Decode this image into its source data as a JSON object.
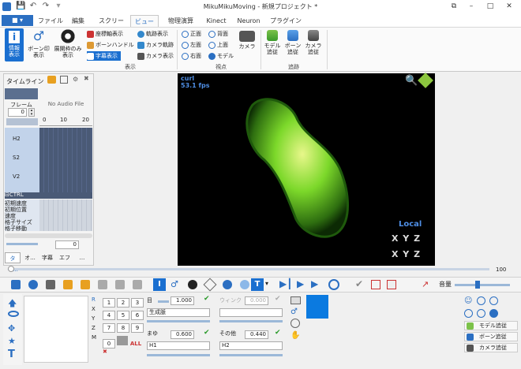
{
  "window": {
    "title": "MikuMikuMoving - 新規プロジェクト *"
  },
  "quick_access": [
    "save",
    "undo",
    "redo"
  ],
  "menu_tabs": [
    {
      "label": "ファイル",
      "active": false
    },
    {
      "label": "編集",
      "active": false
    },
    {
      "label": "スクリーン",
      "active": false
    },
    {
      "label": "ビュー",
      "active": true
    },
    {
      "label": "物理演算",
      "active": false
    },
    {
      "label": "Kinect",
      "active": false
    },
    {
      "label": "Neuron",
      "active": false
    },
    {
      "label": "プラグイン",
      "active": false
    }
  ],
  "file_button": "■ ▾",
  "ribbon": {
    "display_group": "表示",
    "viewpoint_group": "視点",
    "tracking_group": "追跡",
    "info_btn": "情報\n表示",
    "bone_mark_btn": "ボーン印\n表示",
    "expand_only_btn": "展開枠のみ\n表示",
    "small_items": [
      "座標軸表示",
      "ボーンハンドル",
      "字幕表示",
      "軌跡表示",
      "カメラ軌跡",
      "カメラ表示"
    ],
    "view_items": [
      "正面",
      "背面",
      "左面",
      "上面",
      "右面",
      "モデル"
    ],
    "camera_btn": "カメラ",
    "track_items": [
      "モデル\n追従",
      "ボーン\n追従",
      "カメラ\n追従"
    ]
  },
  "timeline": {
    "title": "タイムライン",
    "frame_label": "フレーム",
    "frame_value": "0",
    "audio": "No Audio File",
    "ticks": [
      "0",
      "10",
      "20"
    ],
    "tracks": [
      "H2",
      "S2",
      "V2"
    ],
    "ctrl_items": [
      "⊟CTRL",
      "初期速度",
      "初期位置",
      "速度",
      "格子サイズ",
      "格子移動"
    ],
    "bottom_value": "0",
    "tabs": [
      "タイ...",
      "オ...",
      "字幕",
      "エフ",
      "..."
    ]
  },
  "viewport": {
    "model_name": "curl",
    "fps": "53.1 fps",
    "local_label": "Local",
    "axis_line1": "X Y Z",
    "axis_line2": "X Y Z"
  },
  "scroll_value": "100",
  "bottom": {
    "vol_label": "音量",
    "numpad": [
      "1",
      "2",
      "3",
      "4",
      "5",
      "6",
      "7",
      "8",
      "9",
      "0"
    ],
    "axis_letters": [
      "R",
      "X",
      "Y",
      "Z",
      "M"
    ],
    "all_label": "ALL",
    "eye_label": "目",
    "eye_value": "1.000",
    "wink_label": "ウィンク",
    "wink_value": "0.000",
    "mouth_select": "生成脈",
    "brow_label": "まゆ",
    "brow_value": "0.600",
    "other_label": "その他",
    "other_value": "0.440",
    "h1_select": "H1",
    "h2_select": "H2",
    "follow_buttons": [
      "モデル追従",
      "ボーン追従",
      "カメラ追従"
    ]
  },
  "colors": {
    "accent": "#1a6fd0",
    "viewport_bg": "#000000",
    "model_green": "#7cd82a",
    "info_blue": "#4f8fe6"
  }
}
